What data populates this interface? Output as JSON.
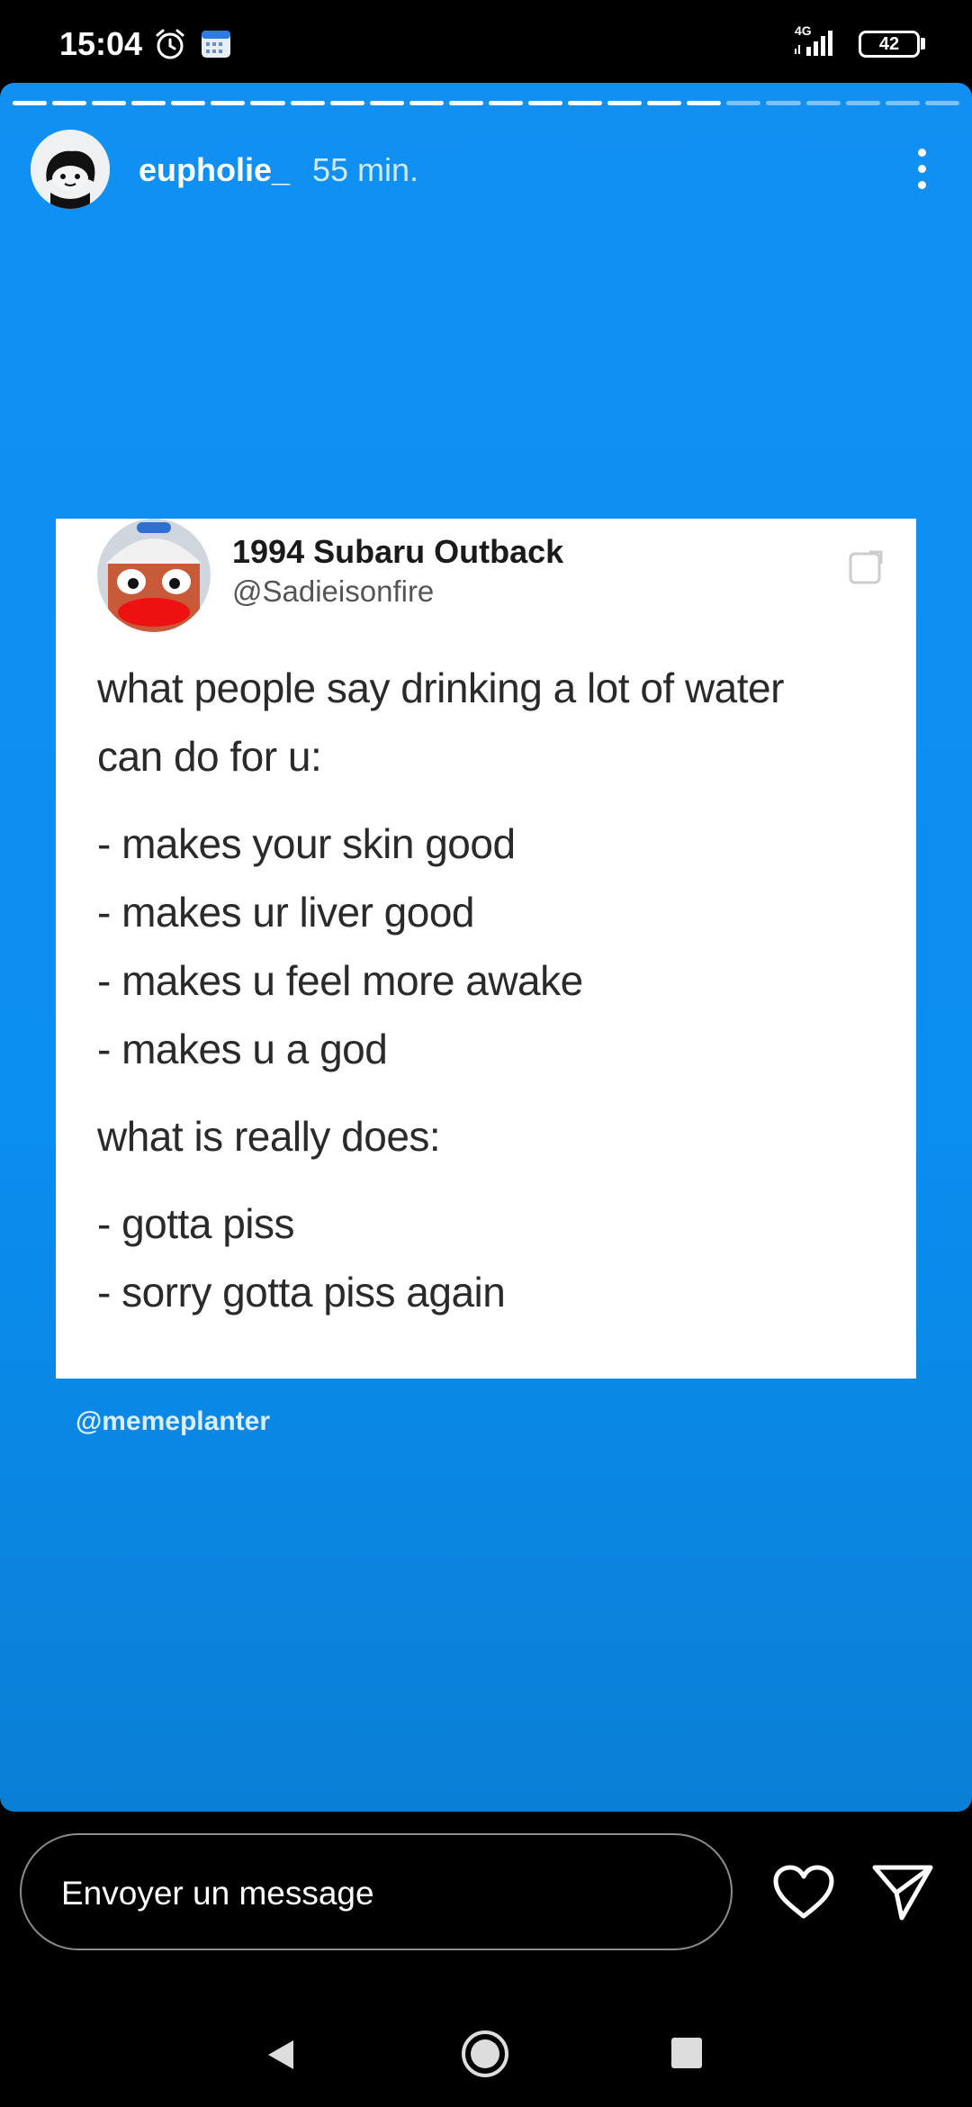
{
  "status_bar": {
    "time": "15:04",
    "network_label": "4G",
    "battery": "42"
  },
  "story": {
    "username": "eupholie_",
    "time_ago": "55 min.",
    "progress": {
      "segments": 24,
      "current": 18
    },
    "credit": "@memeplanter"
  },
  "tweet": {
    "display_name": "1994 Subaru Outback",
    "handle": "@Sadieisonfire",
    "lines": [
      "what people say drinking a lot of water",
      "can do for u:",
      "- makes your skin good",
      "- makes ur liver good",
      "- makes u feel more awake",
      "- makes u a god",
      "what is really does:",
      "- gotta piss",
      "- sorry gotta piss again"
    ]
  },
  "reply_bar": {
    "placeholder": "Envoyer un message"
  },
  "icons": {
    "alarm": "alarm-icon",
    "calendar": "calendar-icon",
    "signal": "signal-icon",
    "more": "more-vertical-icon",
    "share": "share-icon",
    "heart": "heart-icon",
    "send": "send-icon",
    "back": "nav-back-icon",
    "home": "nav-home-icon",
    "recent": "nav-recent-icon"
  },
  "colors": {
    "story_background": "#0a8ef0",
    "card_background": "#ffffff"
  }
}
